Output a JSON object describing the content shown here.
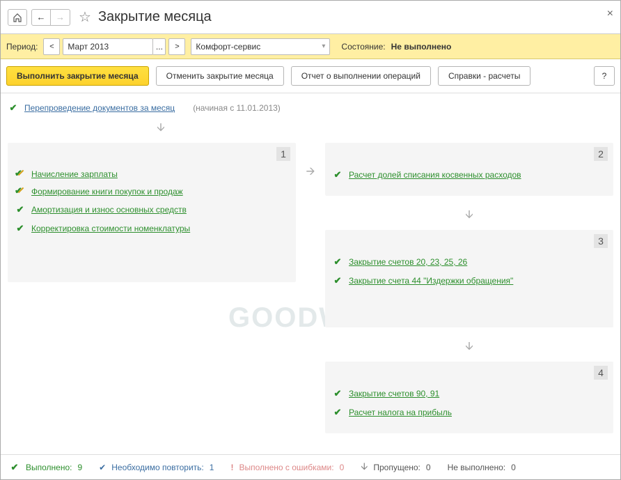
{
  "titlebar": {
    "title": "Закрытие месяца"
  },
  "period": {
    "label": "Период:",
    "month": "Март 2013",
    "org": "Комфорт-сервис",
    "status_label": "Состояние:",
    "status_value": "Не выполнено"
  },
  "actions": {
    "run": "Выполнить закрытие месяца",
    "cancel": "Отменить закрытие месяца",
    "report": "Отчет о выполнении операций",
    "refs": "Справки - расчеты",
    "help": "?"
  },
  "top_op": {
    "label": "Перепроведение документов за месяц",
    "hint": "(начиная с 11.01.2013)"
  },
  "blocks": {
    "b1": {
      "num": "1",
      "ops": [
        "Начисление зарплаты",
        "Формирование книги покупок и продаж",
        "Амортизация и износ основных средств",
        "Корректировка стоимости номенклатуры"
      ]
    },
    "b2": {
      "num": "2",
      "ops": [
        "Расчет долей списания косвенных расходов"
      ]
    },
    "b3": {
      "num": "3",
      "ops": [
        "Закрытие счетов 20, 23, 25, 26",
        "Закрытие счета 44 \"Издержки обращения\""
      ]
    },
    "b4": {
      "num": "4",
      "ops": [
        "Закрытие счетов 90, 91",
        "Расчет налога на прибыль"
      ]
    }
  },
  "footer": {
    "done_label": "Выполнено:",
    "done": "9",
    "repeat_label": "Необходимо повторить:",
    "repeat": "1",
    "error_label": "Выполнено с ошибками:",
    "error": "0",
    "skip_label": "Пропущено:",
    "skip": "0",
    "not_done_label": "Не выполнено:",
    "not_done": "0"
  },
  "watermark": "GOODWILL"
}
